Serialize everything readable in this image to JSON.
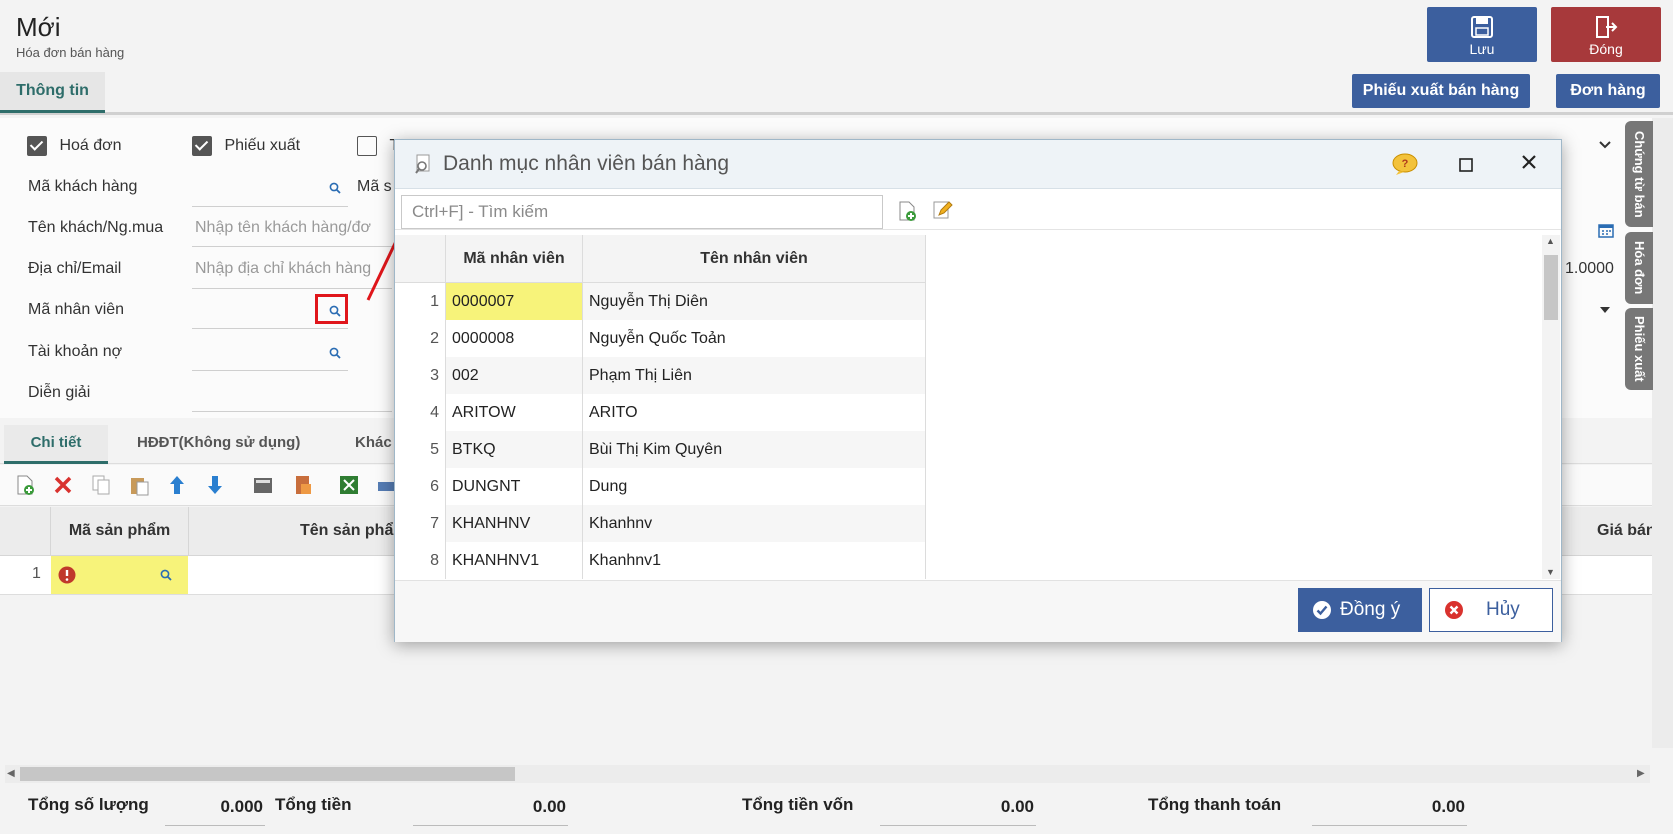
{
  "header": {
    "title": "Mới",
    "subtitle": "Hóa đơn bán hàng",
    "save_label": "Lưu",
    "close_label": "Đóng"
  },
  "tabs": {
    "info": "Thông tin"
  },
  "actions": {
    "export_slip": "Phiếu xuất bán hàng",
    "order": "Đơn hàng"
  },
  "form": {
    "chk_invoice": "Hoá đơn",
    "chk_export": "Phiếu xuất",
    "chk_third": "T",
    "customer_code": "Mã khách hàng",
    "ma_s": "Mã s",
    "customer_name": "Tên khách/Ng.mua",
    "customer_name_ph": "Nhập tên khách hàng/đơ",
    "address": "Địa chỉ/Email",
    "address_ph": "Nhập địa chỉ khách hàng",
    "employee_code": "Mã nhân viên",
    "debit_account": "Tài khoản nợ",
    "description": "Diễn giải",
    "rate": "1.0000"
  },
  "detail_tabs": {
    "detail": "Chi tiết",
    "einvoice": "HĐĐT(Không sử dụng)",
    "other": "Khác"
  },
  "grid": {
    "col_product_code": "Mã sản phẩm",
    "col_product_name": "Tên sản phẩ",
    "col_partial": ")",
    "col_price": "Giá bán",
    "row_no": "1"
  },
  "footer": {
    "total_qty_label": "Tổng số lượng",
    "total_qty": "0.000",
    "total_amount_label": "Tổng tiền",
    "total_amount": "0.00",
    "total_cost_label": "Tổng tiền vốn",
    "total_cost": "0.00",
    "total_pay_label": "Tổng thanh toán",
    "total_pay": "0.00"
  },
  "side_tabs": [
    "Chứng từ bán",
    "Hóa đơn",
    "Phiếu xuất"
  ],
  "modal": {
    "title": "Danh mục nhân viên bán hàng",
    "search_placeholder": "Ctrl+F] - Tìm kiếm",
    "col_code": "Mã nhân viên",
    "col_name": "Tên nhân viên",
    "rows": [
      {
        "no": "1",
        "code": "0000007",
        "name": "Nguyễn Thị Diên"
      },
      {
        "no": "2",
        "code": "0000008",
        "name": "Nguyễn Quốc Toản"
      },
      {
        "no": "3",
        "code": "002",
        "name": "Phạm Thị Liên"
      },
      {
        "no": "4",
        "code": "ARITOW",
        "name": "ARITO"
      },
      {
        "no": "5",
        "code": "BTKQ",
        "name": "Bùi Thị Kim Quyên"
      },
      {
        "no": "6",
        "code": "DUNGNT",
        "name": "Dung"
      },
      {
        "no": "7",
        "code": "KHANHNV",
        "name": "Khanhnv"
      },
      {
        "no": "8",
        "code": "KHANHNV1",
        "name": "Khanhnv1"
      }
    ],
    "ok_label": "Đồng ý",
    "cancel_label": "Hủy"
  },
  "colors": {
    "primary": "#3c5f9e",
    "danger": "#a7393b",
    "accent": "#2e6d6a",
    "highlight": "#f7f37a",
    "callout": "#e0161b"
  }
}
